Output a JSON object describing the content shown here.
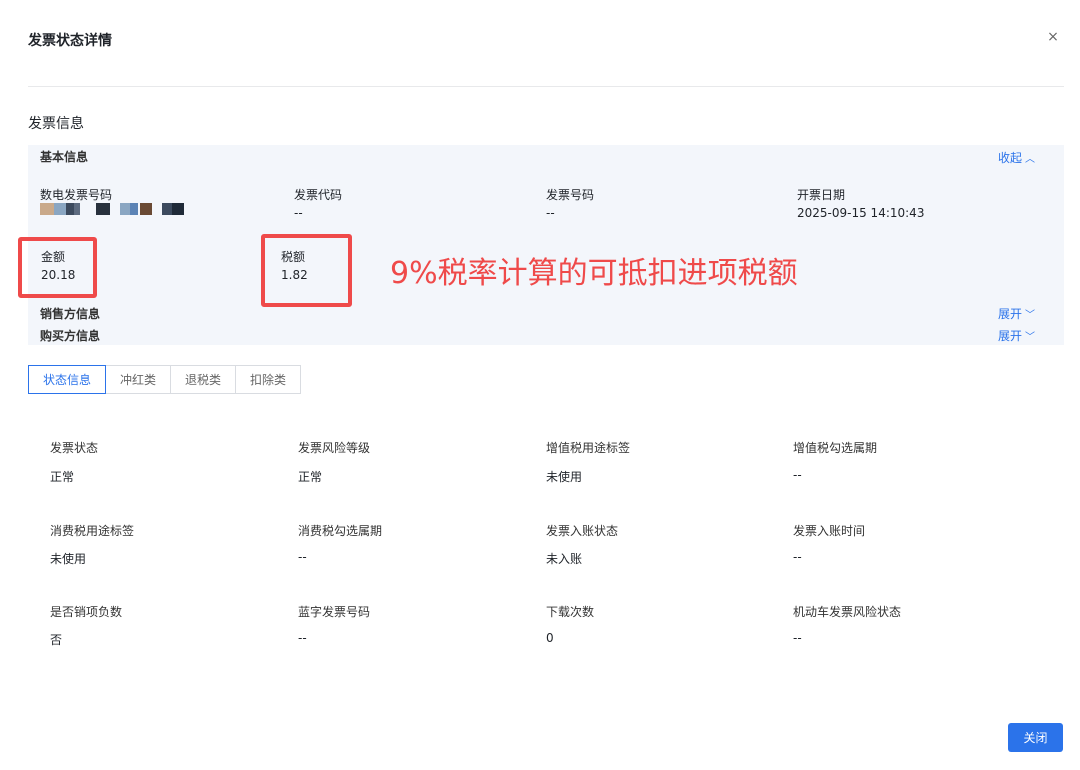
{
  "dialog": {
    "title": "发票状态详情",
    "close_icon": "×"
  },
  "section_title": "发票信息",
  "basic": {
    "title": "基本信息",
    "collapse_label": "收起",
    "fields": {
      "digital_invoice_no": {
        "label": "数电发票号码",
        "value": ""
      },
      "invoice_code": {
        "label": "发票代码",
        "value": "--"
      },
      "invoice_no": {
        "label": "发票号码",
        "value": "--"
      },
      "issue_date": {
        "label": "开票日期",
        "value": "2025-09-15 14:10:43"
      },
      "amount": {
        "label": "金额",
        "value": "20.18"
      },
      "tax": {
        "label": "税额",
        "value": "1.82"
      }
    }
  },
  "annotation": "9%税率计算的可抵扣进项税额",
  "seller": {
    "title": "销售方信息",
    "expand_label": "展开"
  },
  "buyer": {
    "title": "购买方信息",
    "expand_label": "展开"
  },
  "tabs": [
    "状态信息",
    "冲红类",
    "退税类",
    "扣除类"
  ],
  "status": {
    "invoice_status": {
      "label": "发票状态",
      "value": "正常"
    },
    "risk_level": {
      "label": "发票风险等级",
      "value": "正常"
    },
    "vat_purpose": {
      "label": "增值税用途标签",
      "value": "未使用"
    },
    "vat_period": {
      "label": "增值税勾选属期",
      "value": "--"
    },
    "consumption_purpose": {
      "label": "消费税用途标签",
      "value": "未使用"
    },
    "consumption_period": {
      "label": "消费税勾选属期",
      "value": "--"
    },
    "entry_status": {
      "label": "发票入账状态",
      "value": "未入账"
    },
    "entry_time": {
      "label": "发票入账时间",
      "value": "--"
    },
    "negative_sales": {
      "label": "是否销项负数",
      "value": "否"
    },
    "blue_invoice_no": {
      "label": "蓝字发票号码",
      "value": "--"
    },
    "download_count": {
      "label": "下载次数",
      "value": "0"
    },
    "vehicle_risk": {
      "label": "机动车发票风险状态",
      "value": "--"
    }
  },
  "footer": {
    "close_label": "关闭"
  },
  "colors": {
    "accent": "#2b73ea",
    "annotation": "#ef4a4a",
    "panel": "#f3f6fb"
  }
}
